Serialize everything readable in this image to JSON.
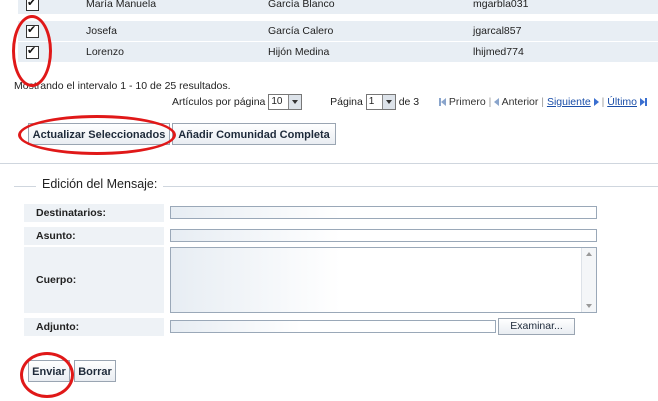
{
  "table": {
    "rows": [
      {
        "first": "María Manuela",
        "last": "García Blanco",
        "user": "mgarbla031"
      },
      {
        "first": "Josefa",
        "last": "García Calero",
        "user": "jgarcal857"
      },
      {
        "first": "Lorenzo",
        "last": "Hijón Medina",
        "user": "lhijmed774"
      }
    ]
  },
  "pagination": {
    "info": "Mostrando el intervalo 1 - 10 de 25 resultados.",
    "per_page_label": "Artículos por página",
    "per_page_value": "10",
    "page_label": "Página",
    "page_value": "1",
    "of_label": "de 3",
    "first": "Primero",
    "prev": "Anterior",
    "next": "Siguiente",
    "last": "Último"
  },
  "actions": {
    "update_selected": "Actualizar Seleccionados",
    "add_community": "Añadir Comunidad Completa"
  },
  "message": {
    "section_title": "Edición del Mensaje:",
    "recipients_label": "Destinatarios:",
    "subject_label": "Asunto:",
    "body_label": "Cuerpo:",
    "attachment_label": "Adjunto:",
    "browse_button": "Examinar...",
    "send_button": "Enviar",
    "delete_button": "Borrar"
  },
  "colors": {
    "highlight": "#e01818",
    "row_background": "#e8eef4",
    "link": "#1a4ea8"
  }
}
